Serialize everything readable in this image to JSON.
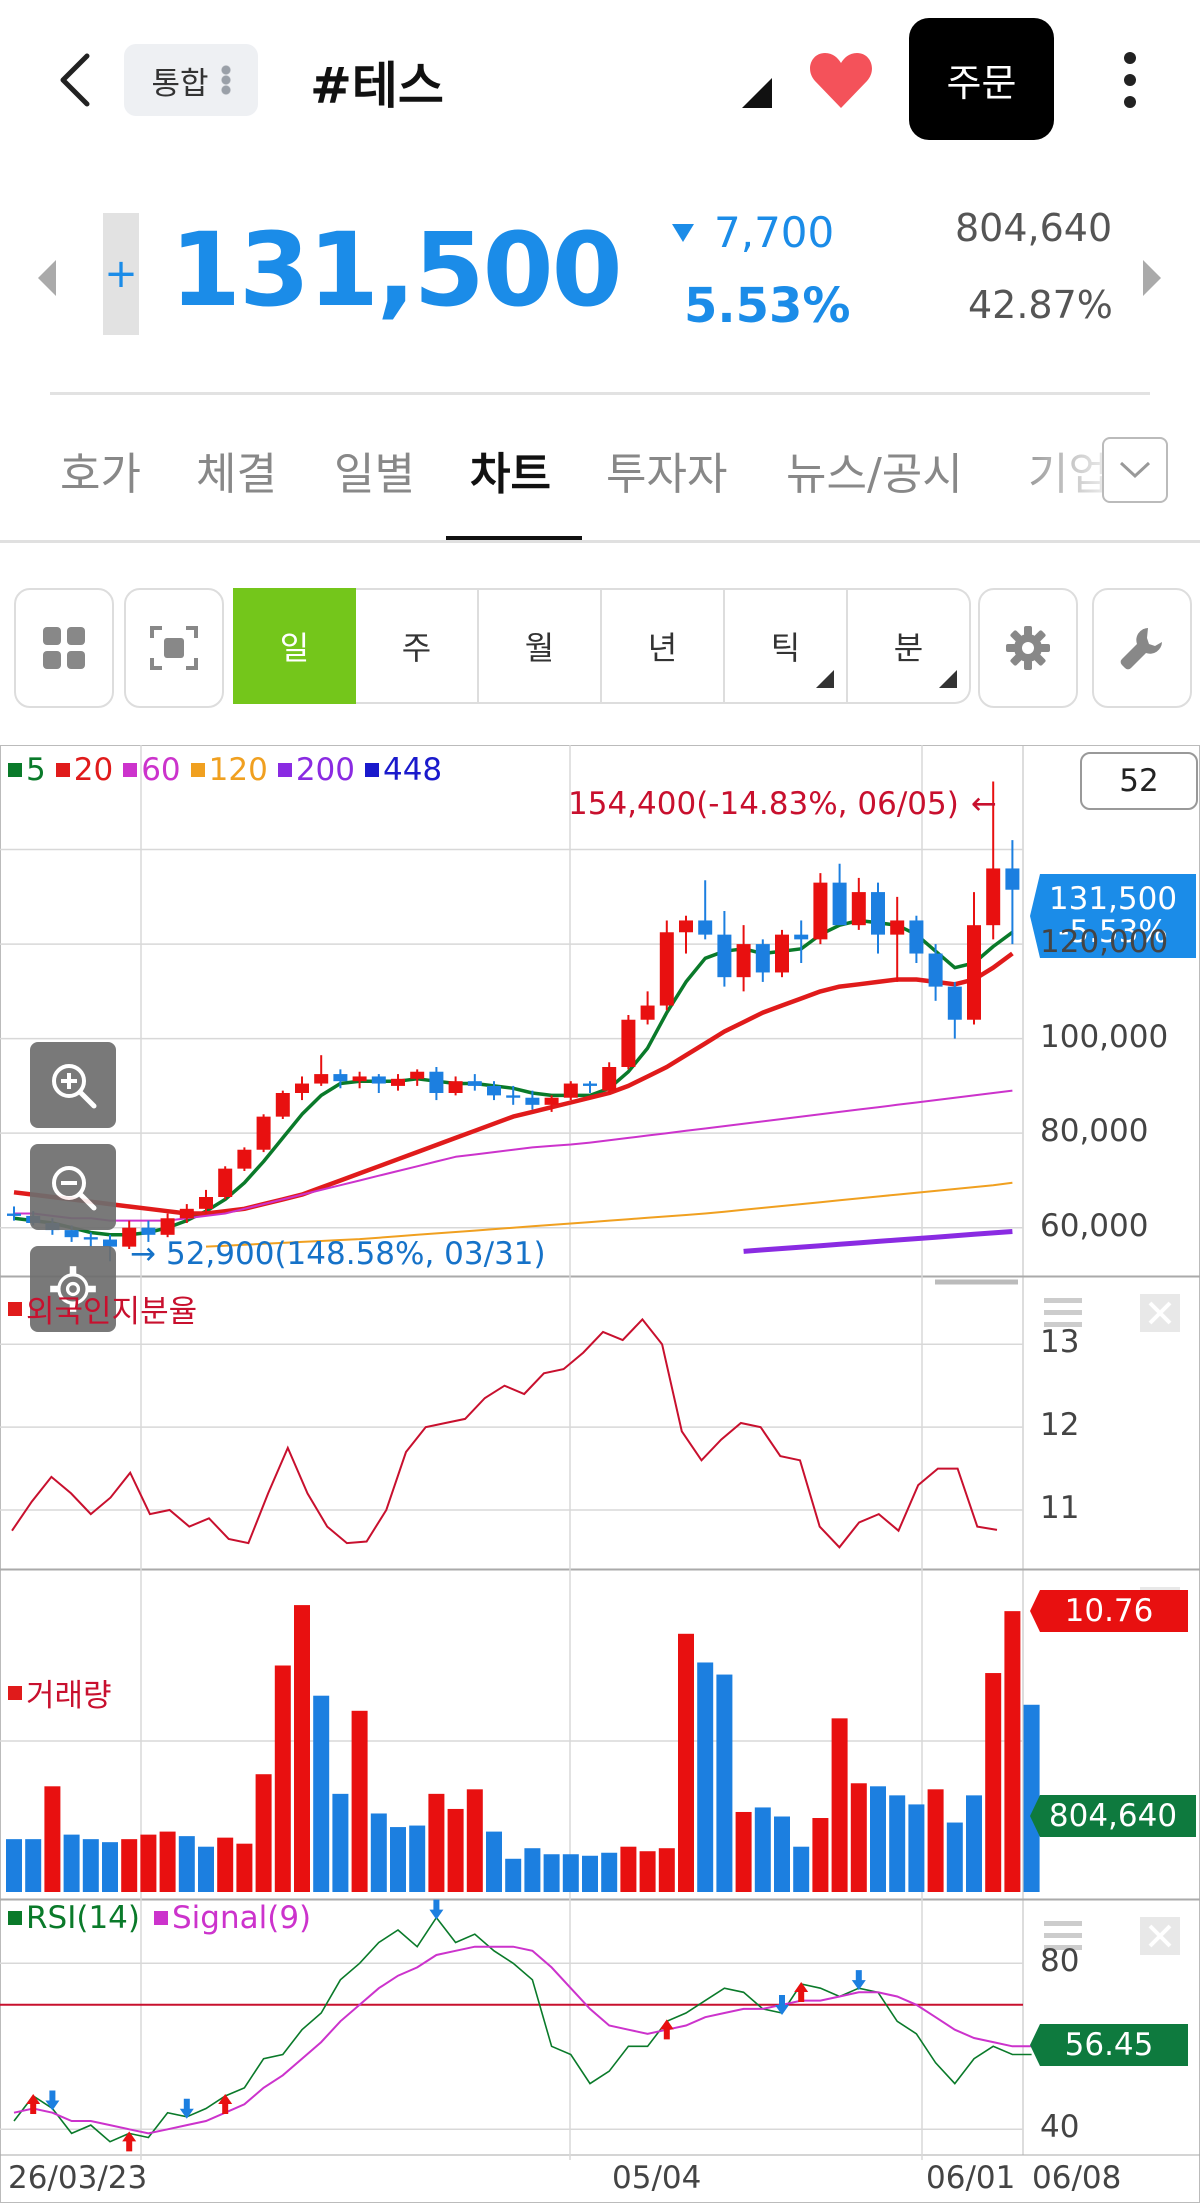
{
  "header": {
    "market": "통합",
    "title": "#테스",
    "order_label": "주문"
  },
  "quote": {
    "price": "131,500",
    "change": "7,700",
    "change_pct": "5.53%",
    "volume": "804,640",
    "ratio": "42.87%",
    "color": "#1b8ce8"
  },
  "tabs": [
    "호가",
    "체결",
    "일별",
    "차트",
    "투자자",
    "뉴스/공시",
    "기업"
  ],
  "active_tab": "차트",
  "periods": [
    {
      "label": "일",
      "active": true,
      "sub": false
    },
    {
      "label": "주",
      "active": false,
      "sub": false
    },
    {
      "label": "월",
      "active": false,
      "sub": false
    },
    {
      "label": "년",
      "active": false,
      "sub": false
    },
    {
      "label": "틱",
      "active": false,
      "sub": true
    },
    {
      "label": "분",
      "active": false,
      "sub": true
    }
  ],
  "icons": {
    "back": "chevron-left-icon",
    "favorite": "heart-icon",
    "more": "kebab-menu-icon",
    "layout": "grid-icon",
    "capture": "capture-icon",
    "settings": "gear-icon",
    "tools": "wrench-icon",
    "zoom_in": "zoom-in-icon",
    "zoom_out": "zoom-out-icon"
  },
  "chart_data": {
    "type": "candlestick",
    "count_box": "52",
    "ma_legend": [
      {
        "label": "5",
        "color": "#0a7a2a"
      },
      {
        "label": "20",
        "color": "#e01b1b"
      },
      {
        "label": "60",
        "color": "#cc33cc"
      },
      {
        "label": "120",
        "color": "#f0a020"
      },
      {
        "label": "200",
        "color": "#8a2be2"
      },
      {
        "label": "448",
        "color": "#1a1acc"
      }
    ],
    "x_labels": [
      "26/03/23",
      "05/04",
      "06/01",
      "06/08"
    ],
    "price_axis": [
      "120,000",
      "100,000",
      "80,000",
      "60,000"
    ],
    "price_ylim": [
      50000,
      160000
    ],
    "high_annotation": "154,400(-14.83%, 06/05)",
    "low_annotation": "52,900(148.58%, 03/31)",
    "last_price_tag": [
      "131,500",
      "-5.53%"
    ],
    "candles": [
      [
        63000,
        64500,
        61500,
        62500
      ],
      [
        62500,
        63500,
        60500,
        61000
      ],
      [
        61000,
        62000,
        58500,
        59500
      ],
      [
        59500,
        60500,
        57000,
        58000
      ],
      [
        58000,
        59000,
        56000,
        57500
      ],
      [
        57500,
        58500,
        52900,
        56000
      ],
      [
        56000,
        61500,
        55500,
        60000
      ],
      [
        60000,
        61500,
        57000,
        58500
      ],
      [
        58500,
        63000,
        58000,
        62000
      ],
      [
        62000,
        65000,
        61000,
        64000
      ],
      [
        64000,
        68000,
        63000,
        66500
      ],
      [
        66500,
        73000,
        66000,
        72500
      ],
      [
        72500,
        77000,
        72000,
        76500
      ],
      [
        76500,
        84000,
        76000,
        83500
      ],
      [
        83500,
        89000,
        83000,
        88500
      ],
      [
        88500,
        92000,
        87000,
        90500
      ],
      [
        90500,
        96500,
        90000,
        92500
      ],
      [
        92500,
        93500,
        89500,
        91000
      ],
      [
        91000,
        93000,
        89500,
        92000
      ],
      [
        92000,
        92500,
        88500,
        90500
      ],
      [
        90000,
        92500,
        89000,
        91500
      ],
      [
        91500,
        93500,
        90000,
        93000
      ],
      [
        93000,
        94000,
        87000,
        88500
      ],
      [
        88500,
        92000,
        88000,
        91000
      ],
      [
        91000,
        92500,
        89000,
        90000
      ],
      [
        90000,
        91000,
        87000,
        88000
      ],
      [
        88000,
        90000,
        86000,
        87500
      ],
      [
        87500,
        89000,
        85000,
        86000
      ],
      [
        86000,
        88000,
        84500,
        87500
      ],
      [
        87500,
        91000,
        87000,
        90500
      ],
      [
        90500,
        91000,
        88500,
        90000
      ],
      [
        89000,
        95000,
        88500,
        94000
      ],
      [
        94000,
        105000,
        93500,
        104000
      ],
      [
        104000,
        110000,
        103000,
        107000
      ],
      [
        107000,
        125000,
        106000,
        122500
      ],
      [
        122500,
        126000,
        118000,
        125000
      ],
      [
        125000,
        133500,
        121000,
        122000
      ],
      [
        122000,
        127000,
        111000,
        113000
      ],
      [
        113000,
        124000,
        110000,
        120000
      ],
      [
        120000,
        121000,
        112000,
        114000
      ],
      [
        114000,
        123000,
        113000,
        122000
      ],
      [
        122000,
        125000,
        116000,
        121000
      ],
      [
        121000,
        135000,
        120000,
        133000
      ],
      [
        133000,
        137000,
        126000,
        124000
      ],
      [
        124000,
        134000,
        123000,
        131000
      ],
      [
        131000,
        133000,
        118000,
        122000
      ],
      [
        122000,
        130000,
        112000,
        125000
      ],
      [
        125000,
        126000,
        116000,
        118000
      ],
      [
        118000,
        120000,
        108000,
        111000
      ],
      [
        111000,
        112000,
        100000,
        104000
      ],
      [
        104000,
        131000,
        103000,
        124000
      ],
      [
        124000,
        154400,
        121000,
        136000
      ],
      [
        136000,
        142000,
        120000,
        131500
      ]
    ],
    "ma_lines": [
      {
        "period": 5,
        "color": "#0a7a2a",
        "width": 3.5,
        "start": 0,
        "values": [
          62000,
          61500,
          61000,
          60000,
          59000,
          58500,
          58500,
          59000,
          60000,
          61500,
          63500,
          66000,
          69500,
          74000,
          79000,
          84000,
          88000,
          90500,
          91000,
          91000,
          91000,
          91500,
          91000,
          90500,
          90500,
          90000,
          89500,
          88500,
          88000,
          88000,
          88000,
          89500,
          93000,
          98000,
          105500,
          112000,
          117000,
          118500,
          119000,
          118000,
          118500,
          119000,
          122000,
          124000,
          125000,
          124500,
          124000,
          122000,
          118500,
          115000,
          116000,
          119500,
          122500
        ]
      },
      {
        "period": 20,
        "color": "#e01b1b",
        "width": 4.5,
        "start": 0,
        "values": [
          67500,
          67000,
          66500,
          66000,
          65500,
          65000,
          64500,
          64000,
          63500,
          63000,
          63000,
          63500,
          64000,
          65000,
          66000,
          67000,
          68500,
          70000,
          71500,
          73000,
          74500,
          76000,
          77500,
          79000,
          80500,
          82000,
          83500,
          84500,
          85500,
          86500,
          87500,
          88500,
          90000,
          92000,
          94000,
          96500,
          99000,
          101500,
          103500,
          105500,
          107000,
          108500,
          110000,
          111000,
          111500,
          112000,
          112500,
          112500,
          112000,
          111500,
          112500,
          115000,
          118000
        ]
      },
      {
        "period": 60,
        "color": "#cc33cc",
        "width": 2,
        "start": 0,
        "values": [
          63000,
          63000,
          62500,
          62000,
          62000,
          61500,
          61500,
          61500,
          61500,
          62000,
          62500,
          63000,
          64000,
          65000,
          66000,
          67000,
          68000,
          69000,
          70000,
          71000,
          72000,
          73000,
          74000,
          75000,
          75500,
          76000,
          76500,
          77000,
          77300,
          77600,
          78000,
          78500,
          79000,
          79500,
          80000,
          80500,
          81000,
          81500,
          82000,
          82500,
          83000,
          83500,
          84000,
          84500,
          85000,
          85500,
          86000,
          86500,
          87000,
          87500,
          88000,
          88500,
          89000
        ]
      },
      {
        "period": 120,
        "color": "#f0a020",
        "width": 2,
        "start": 10,
        "values": [
          56000,
          56200,
          56400,
          56600,
          56800,
          57000,
          57200,
          57400,
          57600,
          57900,
          58200,
          58500,
          58800,
          59100,
          59400,
          59700,
          60000,
          60300,
          60600,
          60900,
          61200,
          61500,
          61800,
          62100,
          62400,
          62700,
          63000,
          63400,
          63800,
          64200,
          64600,
          65000,
          65400,
          65800,
          66200,
          66600,
          67000,
          67400,
          67800,
          68200,
          68600,
          69000,
          69500
        ]
      },
      {
        "period": 200,
        "color": "#8a2be2",
        "width": 5,
        "start": 38,
        "values": [
          55000,
          55300,
          55600,
          55900,
          56200,
          56500,
          56800,
          57100,
          57400,
          57700,
          58000,
          58300,
          58600,
          58900,
          59200
        ]
      }
    ],
    "foreign": {
      "label": "외국인지분율",
      "color": "#c8102e",
      "axis": [
        "13",
        "12",
        "11"
      ],
      "ylim": [
        10.3,
        13.8
      ],
      "last_tag": "10.76",
      "values": [
        10.75,
        11.1,
        11.4,
        11.2,
        10.95,
        11.15,
        11.45,
        10.95,
        11.0,
        10.8,
        10.9,
        10.65,
        10.6,
        11.2,
        11.75,
        11.2,
        10.8,
        10.6,
        10.62,
        11.0,
        11.7,
        12.0,
        12.05,
        12.1,
        12.35,
        12.5,
        12.4,
        12.65,
        12.7,
        12.9,
        13.15,
        13.05,
        13.3,
        13.0,
        11.95,
        11.6,
        11.85,
        12.05,
        12.0,
        11.65,
        11.6,
        10.8,
        10.55,
        10.85,
        10.95,
        10.75,
        11.3,
        11.5,
        11.5,
        10.8,
        10.76
      ]
    },
    "volume": {
      "label": "거래량",
      "last_tag": "804,640",
      "values": [
        350,
        350,
        700,
        380,
        350,
        330,
        350,
        380,
        400,
        370,
        300,
        360,
        320,
        780,
        1500,
        1900,
        1300,
        650,
        1200,
        520,
        430,
        440,
        650,
        550,
        680,
        400,
        220,
        290,
        250,
        250,
        240,
        260,
        300,
        270,
        290,
        1710,
        1520,
        1440,
        530,
        560,
        500,
        300,
        490,
        1150,
        720,
        700,
        640,
        580,
        680,
        460,
        640,
        1450,
        1860,
        1240
      ],
      "colors": [
        "b",
        "b",
        "r",
        "b",
        "b",
        "b",
        "r",
        "r",
        "r",
        "b",
        "b",
        "r",
        "r",
        "r",
        "r",
        "r",
        "b",
        "b",
        "r",
        "b",
        "b",
        "b",
        "r",
        "r",
        "r",
        "b",
        "b",
        "b",
        "b",
        "b",
        "b",
        "b",
        "r",
        "r",
        "r",
        "r",
        "b",
        "b",
        "r",
        "b",
        "b",
        "b",
        "r",
        "r",
        "r",
        "b",
        "b",
        "b",
        "r",
        "b",
        "b",
        "r",
        "r",
        "b"
      ]
    },
    "rsi": {
      "label": "RSI(14)",
      "signal_label": "Signal(9)",
      "axis": [
        "80",
        "40"
      ],
      "ylim": [
        35,
        95
      ],
      "threshold": 70,
      "last_tag": "56.45",
      "values": [
        42,
        48,
        45,
        39,
        41,
        37,
        39,
        38,
        44,
        43,
        45,
        48,
        50,
        57,
        58,
        64,
        68,
        76,
        80,
        85,
        88,
        84,
        91,
        85,
        87,
        83,
        80,
        76,
        60,
        58,
        51,
        54,
        60,
        60,
        66,
        68,
        71,
        74,
        73,
        69,
        68,
        75,
        74,
        72,
        74,
        73,
        66,
        63,
        56,
        51,
        57,
        60,
        58,
        58
      ],
      "signal": [
        44,
        45,
        44,
        42,
        42,
        41,
        40,
        39,
        40,
        41,
        42,
        44,
        46,
        50,
        53,
        57,
        61,
        66,
        70,
        74,
        77,
        79,
        82,
        83,
        84,
        84,
        84,
        83,
        79,
        74,
        69,
        65,
        64,
        63,
        64,
        65,
        67,
        68,
        69,
        69,
        70,
        71,
        71,
        72,
        73,
        73,
        72,
        70,
        67,
        64,
        62,
        61,
        60,
        60
      ]
    }
  }
}
